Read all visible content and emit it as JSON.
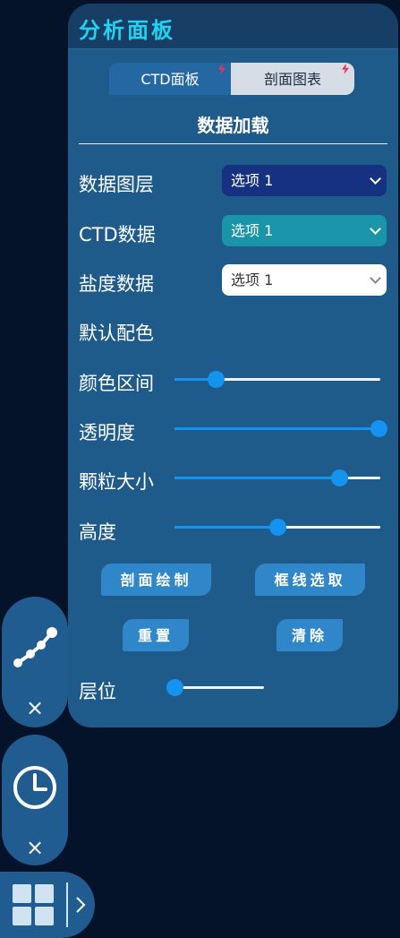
{
  "panel": {
    "title": "分析面板",
    "tabs": [
      {
        "label": "CTD面板",
        "active": true
      },
      {
        "label": "剖面图表",
        "active": false
      }
    ],
    "section_title": "数据加载",
    "data_layer": {
      "label": "数据图层",
      "value": "选项 1"
    },
    "ctd_data": {
      "label": "CTD数据",
      "value": "选项 1"
    },
    "salinity_data": {
      "label": "盐度数据",
      "value": "选项 1"
    },
    "default_color": {
      "label": "默认配色"
    },
    "color_range": {
      "label": "颜色区间",
      "value": 0.2
    },
    "opacity": {
      "label": "透明度",
      "value": 1.0
    },
    "particle_size": {
      "label": "颗粒大小",
      "value": 0.8
    },
    "height": {
      "label": "高度",
      "value": 0.5
    },
    "buttons": {
      "profile_draw": "剖面绘制",
      "box_select": "框线选取",
      "reset": "重置",
      "clear": "清除"
    },
    "layer_level": {
      "label": "层位",
      "value": 0.0
    }
  },
  "dock": {
    "close_symbol": "×",
    "items": [
      {
        "icon": "line-chart-icon"
      },
      {
        "icon": "clock-icon"
      }
    ]
  },
  "bottom_bar": {
    "icon": "grid-icon",
    "expand_icon": "chevron-right-icon"
  },
  "colors": {
    "page_bg": "#05132a",
    "panel_bg": "#1f5b8a",
    "title": "#1fd3f2",
    "accent": "#1493f0",
    "button": "#2f86c8"
  }
}
